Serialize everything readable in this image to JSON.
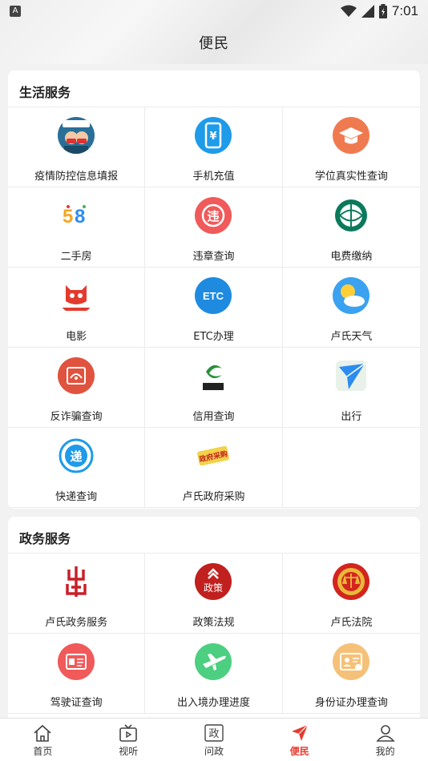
{
  "status_bar": {
    "notification": "A",
    "time": "7:01"
  },
  "header": {
    "title": "便民"
  },
  "life_services": {
    "title": "生活服务",
    "items": [
      {
        "label": "疫情防控信息填报",
        "icon": "epidemic-report-icon",
        "color": "#2a6f97"
      },
      {
        "label": "手机充值",
        "icon": "phone-recharge-icon",
        "color": "#1e9be9"
      },
      {
        "label": "学位真实性查询",
        "icon": "degree-verify-icon",
        "color": "#f07a50"
      },
      {
        "label": "二手房",
        "icon": "58-icon",
        "color": "#ffffff"
      },
      {
        "label": "违章查询",
        "icon": "violation-icon",
        "color": "#f05a5a"
      },
      {
        "label": "电费缴纳",
        "icon": "state-grid-icon",
        "color": "#0b7a5c"
      },
      {
        "label": "电影",
        "icon": "maoyan-icon",
        "color": "#e23b2e"
      },
      {
        "label": "ETC办理",
        "icon": "etc-icon",
        "color": "#1e8be0"
      },
      {
        "label": "卢氏天气",
        "icon": "weather-icon",
        "color": "#3aa2f0"
      },
      {
        "label": "反诈骗查询",
        "icon": "anti-fraud-icon",
        "color": "#e0533f"
      },
      {
        "label": "信用查询",
        "icon": "credit-icon",
        "color": "#2a8f3a"
      },
      {
        "label": "出行",
        "icon": "travel-icon",
        "color": "#2d8cf0"
      },
      {
        "label": "快递查询",
        "icon": "express-icon",
        "color": "#1e9be9"
      },
      {
        "label": "卢氏政府采购",
        "icon": "gov-purchase-icon",
        "color": "#e8b93a"
      }
    ]
  },
  "gov_services": {
    "title": "政务服务",
    "items": [
      {
        "label": "卢氏政务服务",
        "icon": "gov-service-icon",
        "color": "#c8202a"
      },
      {
        "label": "政策法规",
        "icon": "policy-icon",
        "color": "#c0201e"
      },
      {
        "label": "卢氏法院",
        "icon": "court-icon",
        "color": "#d4241e"
      },
      {
        "label": "驾驶证查询",
        "icon": "license-icon",
        "color": "#f05a5a"
      },
      {
        "label": "出入境办理进度",
        "icon": "immigration-icon",
        "color": "#4ccf80"
      },
      {
        "label": "身份证办理查询",
        "icon": "id-card-icon",
        "color": "#f5c178"
      }
    ]
  },
  "tabbar": {
    "items": [
      {
        "label": "首页",
        "icon": "home-icon"
      },
      {
        "label": "视听",
        "icon": "tv-icon"
      },
      {
        "label": "问政",
        "icon": "gov-q-icon"
      },
      {
        "label": "便民",
        "icon": "send-icon"
      },
      {
        "label": "我的",
        "icon": "user-icon"
      }
    ],
    "active": "便民",
    "active_color": "#e63a2e"
  }
}
